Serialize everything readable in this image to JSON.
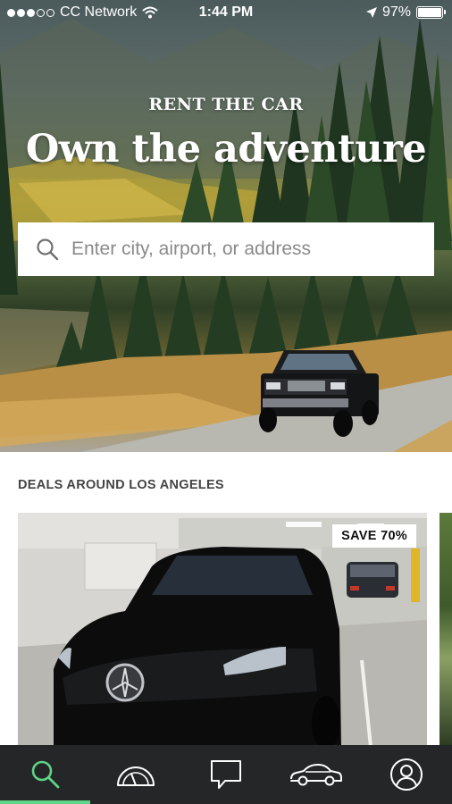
{
  "status_bar": {
    "carrier": "CC Network",
    "time": "1:44 PM",
    "battery": "97%"
  },
  "hero": {
    "brand": "RENT THE CAR",
    "headline": "Own the adventure",
    "search_placeholder": "Enter city, airport, or address"
  },
  "deals": {
    "title": "DEALS AROUND LOS ANGELES",
    "cards": [
      {
        "badge": "SAVE 70%"
      }
    ]
  },
  "tabbar": {
    "tabs": [
      {
        "icon": "search-icon",
        "active": true
      },
      {
        "icon": "speedometer-icon",
        "active": false
      },
      {
        "icon": "chat-icon",
        "active": false
      },
      {
        "icon": "car-icon",
        "active": false
      },
      {
        "icon": "profile-icon",
        "active": false
      }
    ],
    "active_color": "#5ed486",
    "background": "#252627"
  }
}
